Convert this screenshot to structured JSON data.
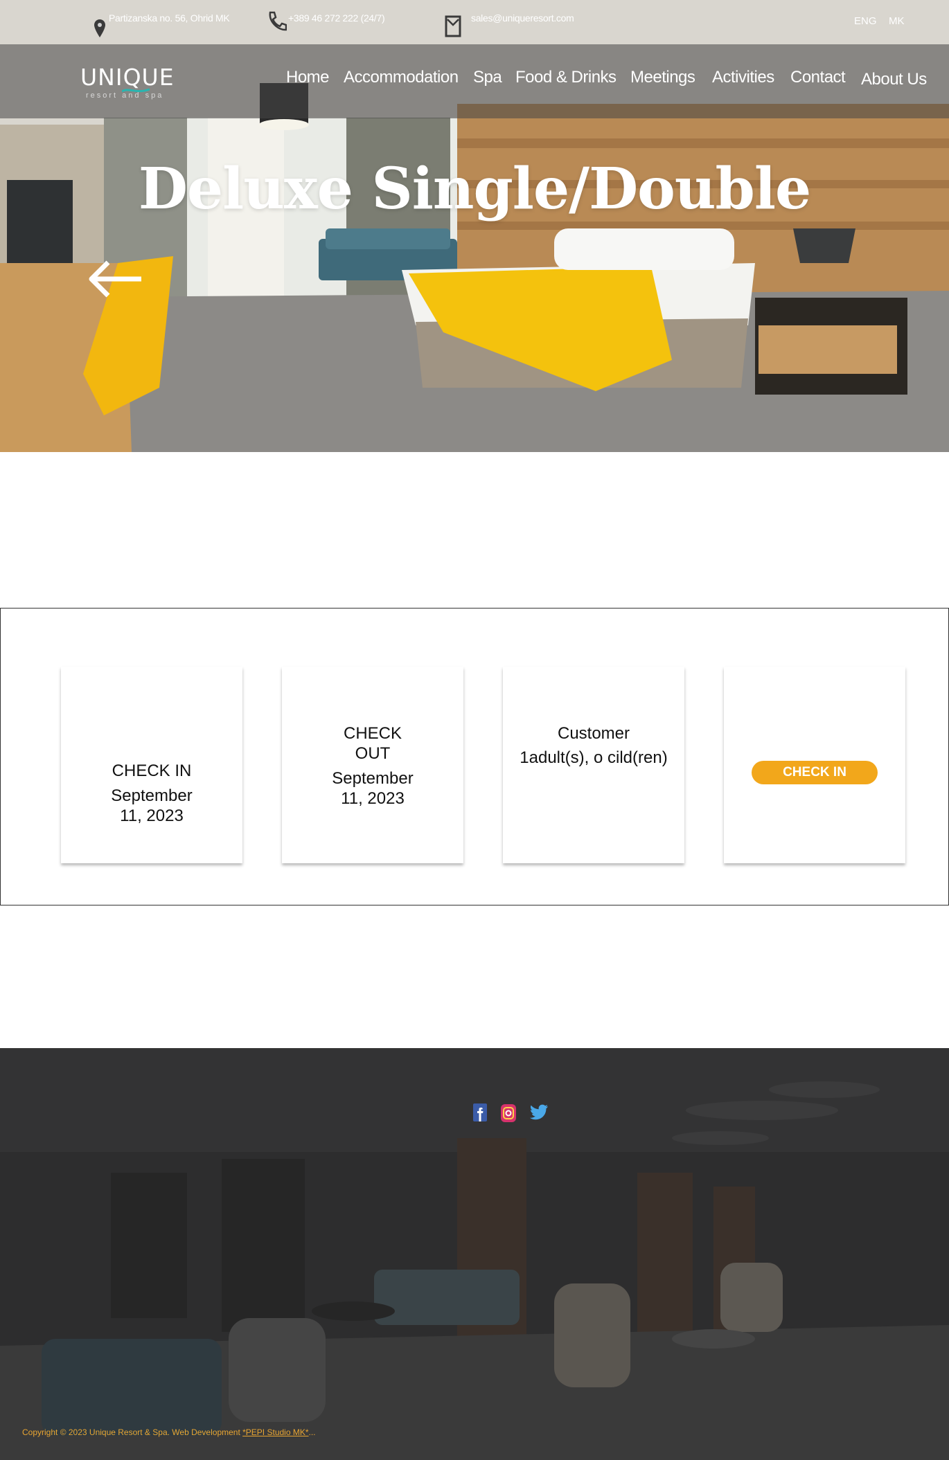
{
  "topbar": {
    "address": "Partizanska no. 56, Ohrid MK",
    "phone": "+389 46 272 222 (24/7)",
    "email": "sales@uniqueresort.com",
    "languages": [
      "ENG",
      "MK"
    ]
  },
  "logo": {
    "word": "UNIQUE",
    "tagline": "resort and spa"
  },
  "nav": {
    "items": [
      "Home",
      "Accommodation",
      "Spa",
      "Food & Drinks",
      "Meetings",
      "Activities",
      "Contact",
      "About Us"
    ]
  },
  "hero": {
    "title": "Deluxe Single/Double"
  },
  "booking": {
    "check_in": {
      "label": "CHECK IN",
      "date_line1": "September",
      "date_line2": "11, 2023"
    },
    "check_out": {
      "label_line1": "CHECK",
      "label_line2": "OUT",
      "date_line1": "September",
      "date_line2": "11, 2023"
    },
    "customer": {
      "label": "Customer",
      "value": "1adult(s), o cild(ren)"
    },
    "button_label": "CHECK IN"
  },
  "footer": {
    "copyright_text": "Copyright © 2023 Unique Resort & Spa. Web Development ",
    "dev_link": "*PEPI Studio MK*",
    "ellipsis": "..."
  },
  "colors": {
    "accent": "#f2a71b",
    "footer_text": "#e8a532",
    "footer_bg": "#2b2b2c"
  }
}
